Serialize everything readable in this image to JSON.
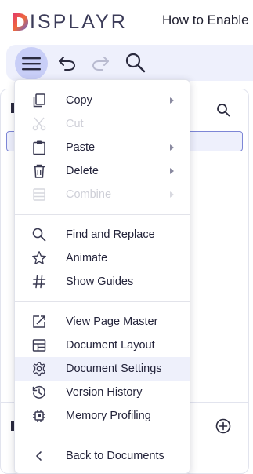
{
  "app": {
    "logo_text": "ISPLAYR",
    "logo_letter": "D",
    "doc_title": "How to Enable"
  },
  "toolbar": {
    "icons": [
      "hamburger-menu-icon",
      "undo-icon",
      "redo-icon",
      "search-icon"
    ],
    "active": "hamburger-menu-icon"
  },
  "menu": {
    "group1": [
      {
        "label": "Copy",
        "icon": "copy-icon",
        "submenu": true,
        "disabled": false
      },
      {
        "label": "Cut",
        "icon": "scissors-icon",
        "submenu": false,
        "disabled": true
      },
      {
        "label": "Paste",
        "icon": "clipboard-icon",
        "submenu": true,
        "disabled": false
      },
      {
        "label": "Delete",
        "icon": "trash-icon",
        "submenu": true,
        "disabled": false
      },
      {
        "label": "Combine",
        "icon": "combine-icon",
        "submenu": true,
        "disabled": true
      }
    ],
    "group2": [
      {
        "label": "Find and Replace",
        "icon": "search-icon"
      },
      {
        "label": "Animate",
        "icon": "star-icon"
      },
      {
        "label": "Show Guides",
        "icon": "hash-icon"
      }
    ],
    "group3": [
      {
        "label": "View Page Master",
        "icon": "page-master-icon"
      },
      {
        "label": "Document Layout",
        "icon": "layout-icon"
      },
      {
        "label": "Document Settings",
        "icon": "gear-icon",
        "hovered": true
      },
      {
        "label": "Version History",
        "icon": "history-icon"
      },
      {
        "label": "Memory Profiling",
        "icon": "chip-icon"
      }
    ],
    "group4": [
      {
        "label": "Back to Documents",
        "icon": "chevron-left-icon"
      }
    ]
  },
  "colors": {
    "toolbar_bg": "#eef0fc",
    "active_button": "#c8cef7",
    "hover_row": "#eef0fb",
    "logo_gradient": [
      "#e23b6a",
      "#f06a3c",
      "#5b5fd6"
    ]
  }
}
